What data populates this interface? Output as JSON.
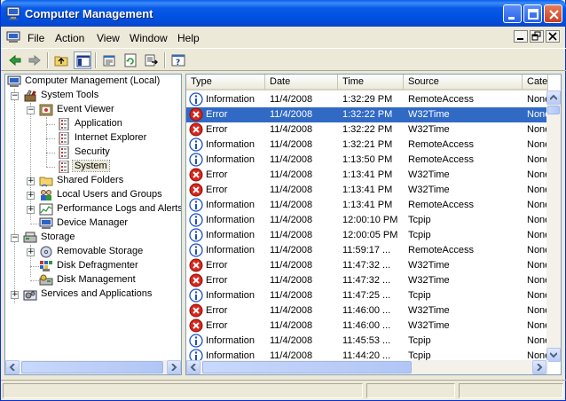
{
  "window": {
    "title": "Computer Management",
    "title_bar_color": "#0054e3",
    "selection_color": "#316ac5"
  },
  "menubar": {
    "items": [
      {
        "label": "File",
        "icon": "none"
      },
      {
        "label": "Action"
      },
      {
        "label": "View"
      },
      {
        "label": "Window"
      },
      {
        "label": "Help"
      }
    ]
  },
  "toolbar": {
    "buttons": [
      "back-arrow-icon",
      "forward-arrow-icon",
      "up-folder-icon",
      "show-hide-tree-icon",
      "properties-icon",
      "refresh-icon",
      "export-list-icon",
      "help-icon"
    ]
  },
  "tree": {
    "items": [
      {
        "label": "Computer Management (Local)",
        "icon": "computer-icon"
      },
      {
        "label": "System Tools",
        "icon": "tools-icon"
      },
      {
        "label": "Event Viewer",
        "icon": "event-viewer-icon"
      },
      {
        "label": "Application",
        "icon": "log-icon"
      },
      {
        "label": "Internet Explorer",
        "icon": "log-icon"
      },
      {
        "label": "Security",
        "icon": "log-icon"
      },
      {
        "label": "System",
        "icon": "log-icon"
      },
      {
        "label": "Shared Folders",
        "icon": "shared-folder-icon"
      },
      {
        "label": "Local Users and Groups",
        "icon": "users-icon"
      },
      {
        "label": "Performance Logs and Alerts",
        "icon": "performance-icon"
      },
      {
        "label": "Device Manager",
        "icon": "device-manager-icon"
      },
      {
        "label": "Storage",
        "icon": "storage-icon"
      },
      {
        "label": "Removable Storage",
        "icon": "removable-storage-icon"
      },
      {
        "label": "Disk Defragmenter",
        "icon": "defrag-icon"
      },
      {
        "label": "Disk Management",
        "icon": "disk-management-icon"
      },
      {
        "label": "Services and Applications",
        "icon": "services-icon"
      }
    ],
    "selected": "System"
  },
  "list": {
    "columns": [
      "Type",
      "Date",
      "Time",
      "Source",
      "Cate"
    ],
    "rows": [
      {
        "type": "Information",
        "date": "11/4/2008",
        "time": "1:32:29 PM",
        "source": "RemoteAccess",
        "category": "None"
      },
      {
        "type": "Error",
        "date": "11/4/2008",
        "time": "1:32:22 PM",
        "source": "W32Time",
        "category": "None",
        "selected": true
      },
      {
        "type": "Error",
        "date": "11/4/2008",
        "time": "1:32:22 PM",
        "source": "W32Time",
        "category": "None"
      },
      {
        "type": "Information",
        "date": "11/4/2008",
        "time": "1:32:21 PM",
        "source": "RemoteAccess",
        "category": "None"
      },
      {
        "type": "Information",
        "date": "11/4/2008",
        "time": "1:13:50 PM",
        "source": "RemoteAccess",
        "category": "None"
      },
      {
        "type": "Error",
        "date": "11/4/2008",
        "time": "1:13:41 PM",
        "source": "W32Time",
        "category": "None"
      },
      {
        "type": "Error",
        "date": "11/4/2008",
        "time": "1:13:41 PM",
        "source": "W32Time",
        "category": "None"
      },
      {
        "type": "Information",
        "date": "11/4/2008",
        "time": "1:13:41 PM",
        "source": "RemoteAccess",
        "category": "None"
      },
      {
        "type": "Information",
        "date": "11/4/2008",
        "time": "12:00:10 PM",
        "source": "Tcpip",
        "category": "None"
      },
      {
        "type": "Information",
        "date": "11/4/2008",
        "time": "12:00:05 PM",
        "source": "Tcpip",
        "category": "None"
      },
      {
        "type": "Information",
        "date": "11/4/2008",
        "time": "11:59:17 ...",
        "source": "RemoteAccess",
        "category": "None"
      },
      {
        "type": "Error",
        "date": "11/4/2008",
        "time": "11:47:32 ...",
        "source": "W32Time",
        "category": "None"
      },
      {
        "type": "Error",
        "date": "11/4/2008",
        "time": "11:47:32 ...",
        "source": "W32Time",
        "category": "None"
      },
      {
        "type": "Information",
        "date": "11/4/2008",
        "time": "11:47:25 ...",
        "source": "Tcpip",
        "category": "None"
      },
      {
        "type": "Error",
        "date": "11/4/2008",
        "time": "11:46:00 ...",
        "source": "W32Time",
        "category": "None"
      },
      {
        "type": "Error",
        "date": "11/4/2008",
        "time": "11:46:00 ...",
        "source": "W32Time",
        "category": "None"
      },
      {
        "type": "Information",
        "date": "11/4/2008",
        "time": "11:45:53 ...",
        "source": "Tcpip",
        "category": "None"
      },
      {
        "type": "Information",
        "date": "11/4/2008",
        "time": "11:44:20 ...",
        "source": "Tcpip",
        "category": "None"
      }
    ]
  },
  "colors": {
    "error": "#d9261c",
    "information": "#1c4fc8"
  }
}
